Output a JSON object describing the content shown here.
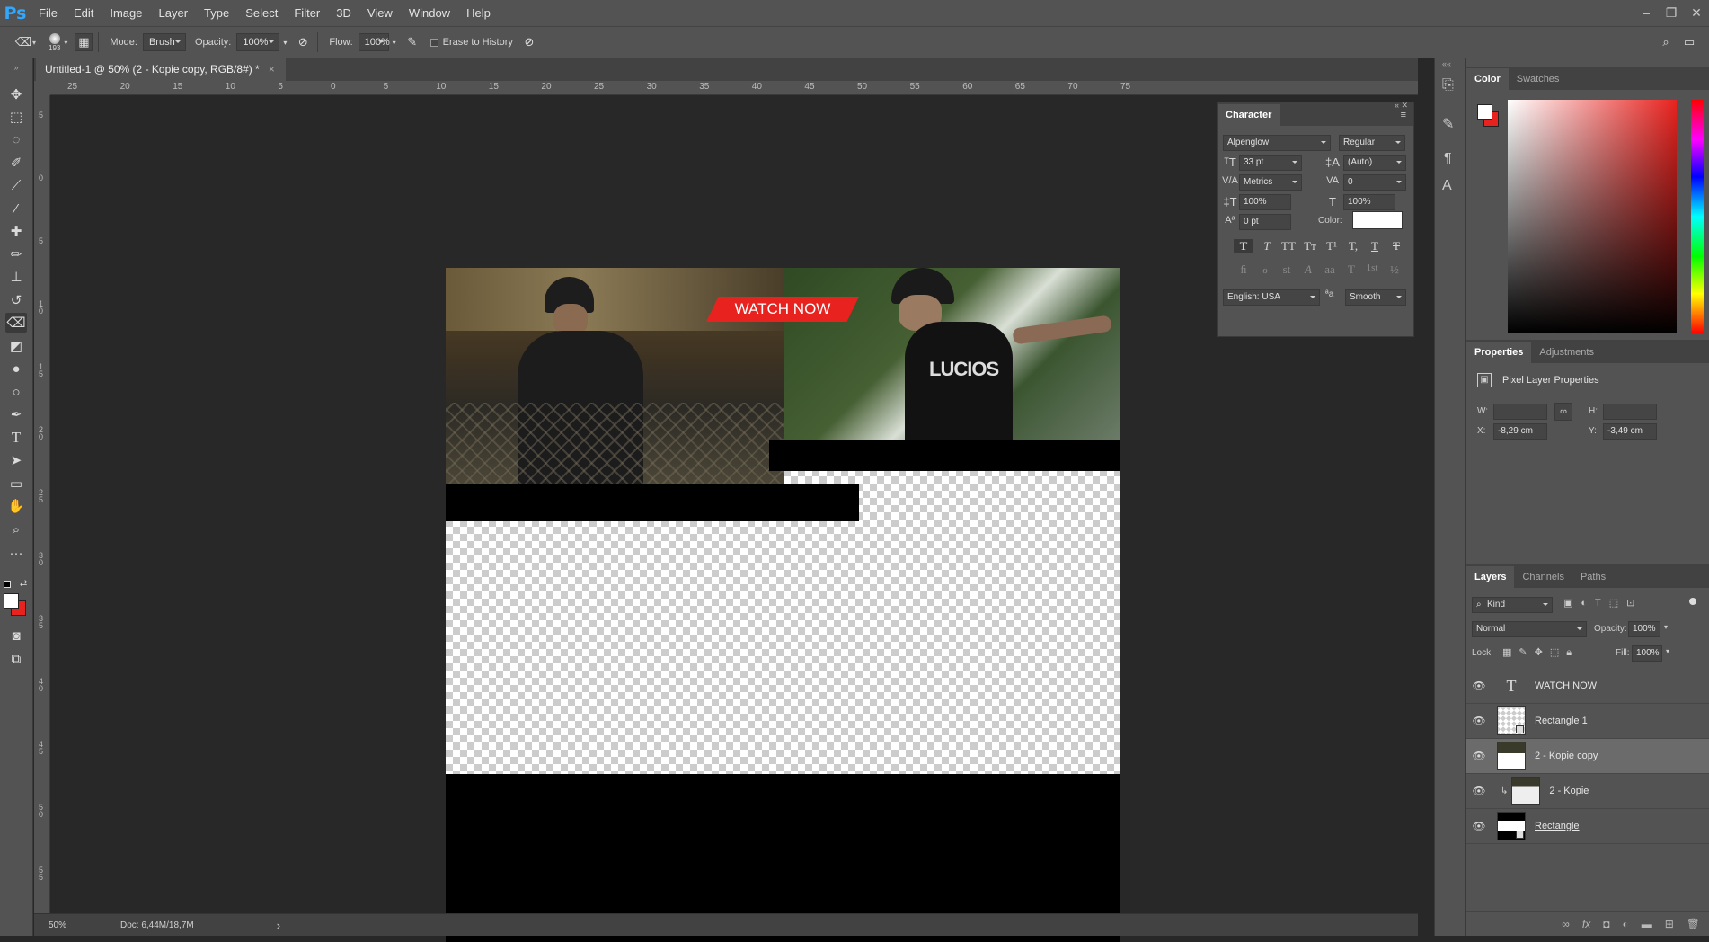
{
  "app": {
    "logo": "Ps"
  },
  "menu": [
    "File",
    "Edit",
    "Image",
    "Layer",
    "Type",
    "Select",
    "Filter",
    "3D",
    "View",
    "Window",
    "Help"
  ],
  "window_controls": [
    "–",
    "❐",
    "✕"
  ],
  "options": {
    "brush_size": "193",
    "mode_label": "Mode:",
    "mode_value": "Brush",
    "opacity_label": "Opacity:",
    "opacity_value": "100%",
    "flow_label": "Flow:",
    "flow_value": "100%",
    "erase_history_label": "Erase to History"
  },
  "document": {
    "tab_title": "Untitled-1 @ 50% (2 - Kopie copy, RGB/8#) *",
    "close": "×",
    "watch_now": "WATCH NOW",
    "shirt_text": "LUCIOS"
  },
  "rulers": {
    "h": [
      "25",
      "20",
      "15",
      "10",
      "5",
      "0",
      "5",
      "10",
      "15",
      "20",
      "25",
      "30",
      "35",
      "40",
      "45",
      "50",
      "55",
      "60",
      "65",
      "70",
      "75"
    ],
    "v": [
      "5",
      "0",
      "5",
      "1\n0",
      "1\n5",
      "2\n0",
      "2\n5",
      "3\n0",
      "3\n5",
      "4\n0",
      "4\n5",
      "5\n0",
      "5\n5"
    ]
  },
  "status": {
    "zoom": "50%",
    "doc": "Doc: 6,44M/18,7M",
    "arrow": "›"
  },
  "character": {
    "tab": "Character",
    "font_family": "Alpenglow",
    "font_style": "Regular",
    "size": "33 pt",
    "leading": "(Auto)",
    "kerning": "Metrics",
    "tracking": "0",
    "vscale": "100%",
    "hscale": "100%",
    "baseline": "0 pt",
    "color_label": "Color:",
    "language": "English: USA",
    "aa_label": "a",
    "antialias": "Smooth",
    "style_glyphs": [
      "T",
      "T",
      "TT",
      "Tт",
      "T¹",
      "T,",
      "T",
      "T"
    ],
    "ot_glyphs": [
      "ﬁ",
      "ℴ",
      "st",
      "A",
      "aa",
      "T",
      "1st",
      "½"
    ]
  },
  "color_panel": {
    "tabs": [
      "Color",
      "Swatches"
    ],
    "fg": "#ffffff",
    "bg": "#e8231f",
    "hue_color": "#e8231f"
  },
  "properties": {
    "tabs": [
      "Properties",
      "Adjustments"
    ],
    "title": "Pixel Layer Properties",
    "w_label": "W:",
    "h_label": "H:",
    "x_label": "X:",
    "x_value": "-8,29 cm",
    "y_label": "Y:",
    "y_value": "-3,49 cm"
  },
  "layers": {
    "tabs": [
      "Layers",
      "Channels",
      "Paths"
    ],
    "filter": "Kind",
    "blend_mode": "Normal",
    "opacity_label": "Opacity:",
    "opacity_value": "100%",
    "lock_label": "Lock:",
    "fill_label": "Fill:",
    "fill_value": "100%",
    "items": [
      {
        "name": "WATCH NOW",
        "type": "text"
      },
      {
        "name": "Rectangle 1",
        "type": "shape"
      },
      {
        "name": "2 - Kopie copy",
        "type": "image",
        "selected": true
      },
      {
        "name": "2 - Kopie",
        "type": "image-clipped"
      },
      {
        "name": "Rectangle",
        "type": "shape-black"
      }
    ],
    "footer_icons": [
      "link-icon",
      "fx-icon",
      "mask-icon",
      "adjustment-icon",
      "folder-icon",
      "new-layer-icon",
      "trash-icon"
    ]
  },
  "colors": {
    "accent_red": "#e8231f",
    "ps_blue": "#31a8ff",
    "panel": "#535353"
  }
}
